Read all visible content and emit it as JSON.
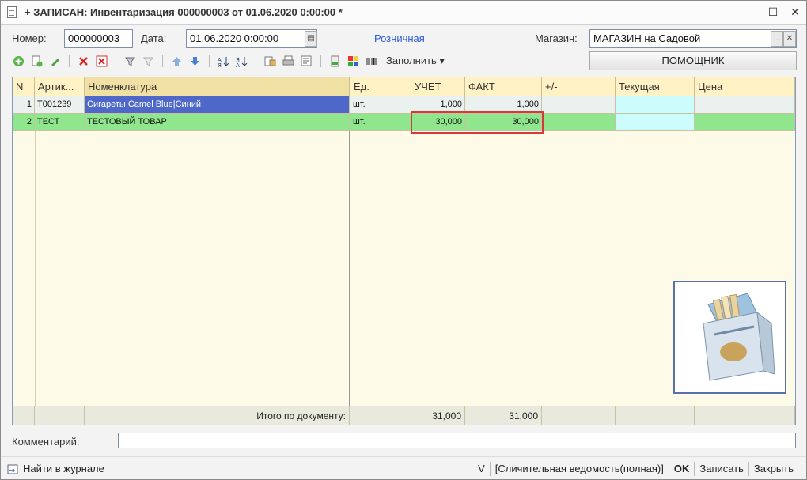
{
  "window": {
    "title": "+ ЗАПИСАН: Инвентаризация 000000003 от 01.06.2020 0:00:00 *",
    "min_label": "‒",
    "max_label": "☐",
    "close_label": "✕"
  },
  "form": {
    "number_label": "Номер:",
    "number_value": "000000003",
    "date_label": "Дата:",
    "date_value": "01.06.2020  0:00:00",
    "type_link": "Розничная",
    "store_label": "Магазин:",
    "store_value": "МАГАЗИН на Садовой",
    "helper_button": "ПОМОЩНИК",
    "fill_button": "Заполнить ▾"
  },
  "table": {
    "left_headers": [
      "N",
      "Артик...",
      "Номенклатура"
    ],
    "right_headers": [
      "Ед.",
      "УЧЕТ",
      "ФАКТ",
      "+/-",
      "Текущая",
      "Цена"
    ],
    "rows": [
      {
        "n": "1",
        "article": "Т001239",
        "name": "Сигареты Camel Blue|Синий",
        "unit": "шт.",
        "uchet": "1,000",
        "fakt": "1,000",
        "diff": "",
        "current": "",
        "price": ""
      },
      {
        "n": "2",
        "article": "ТЕСТ",
        "name": "ТЕСТОВЫЙ ТОВАР",
        "unit": "шт.",
        "uchet": "30,000",
        "fakt": "30,000",
        "diff": "",
        "current": "",
        "price": ""
      }
    ],
    "footer": {
      "total_label": "Итого по документу:",
      "uchet_total": "31,000",
      "fakt_total": "31,000"
    }
  },
  "comment": {
    "label": "Комментарий:",
    "value": ""
  },
  "statusbar": {
    "find_journal": "Найти в журнале",
    "v_label": "V",
    "report_link": "[Сличительная ведомость(полная)]",
    "ok_label": "OK",
    "save_label": "Записать",
    "close_label": "Закрыть"
  },
  "colors": {
    "selected_row": "#8fe68c",
    "selected_cell": "#4d68c8",
    "highlight_border": "#d43a3a",
    "header_bg": "#fff3c6"
  }
}
